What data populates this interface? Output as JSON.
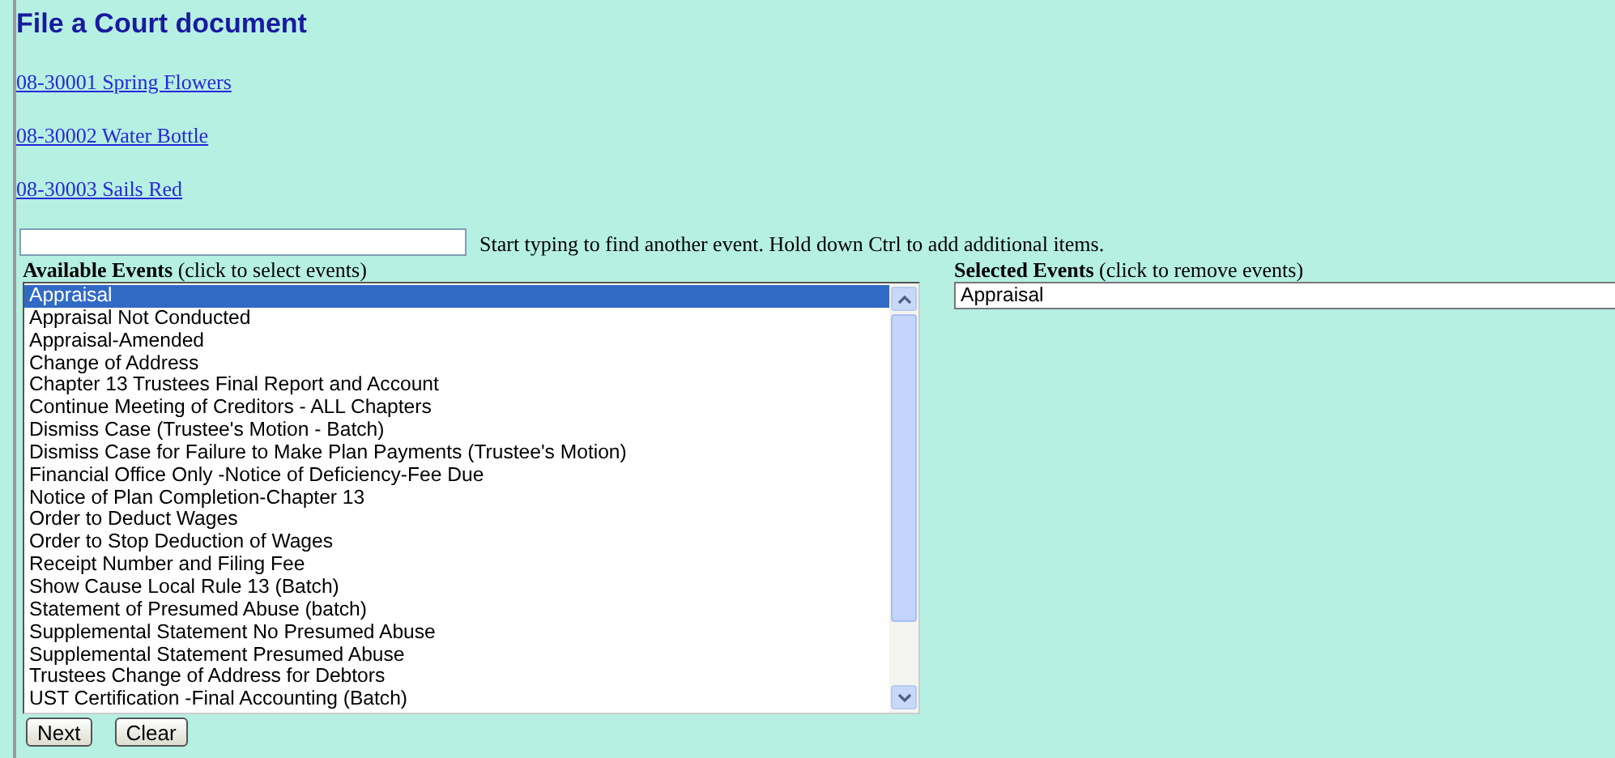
{
  "title": "File a Court document",
  "case_links": [
    "08-30001 Spring Flowers",
    "08-30002 Water Bottle",
    "08-30003 Sails Red"
  ],
  "search": {
    "hint": "Start typing to find another event. Hold down Ctrl to add additional items."
  },
  "available_events": {
    "label": "Available Events",
    "note": "(click to select events)",
    "items": [
      {
        "label": "Appraisal",
        "selected": true
      },
      {
        "label": "Appraisal Not Conducted",
        "selected": false
      },
      {
        "label": "Appraisal-Amended",
        "selected": false
      },
      {
        "label": "Change of Address",
        "selected": false
      },
      {
        "label": "Chapter 13 Trustees Final Report and Account",
        "selected": false
      },
      {
        "label": "Continue Meeting of Creditors - ALL Chapters",
        "selected": false
      },
      {
        "label": "Dismiss Case (Trustee's Motion - Batch)",
        "selected": false
      },
      {
        "label": "Dismiss Case for Failure to Make Plan Payments (Trustee's Motion)",
        "selected": false
      },
      {
        "label": "Financial Office Only -Notice of Deficiency-Fee Due",
        "selected": false
      },
      {
        "label": "Notice of Plan Completion-Chapter 13",
        "selected": false
      },
      {
        "label": "Order to Deduct Wages",
        "selected": false
      },
      {
        "label": "Order to Stop Deduction of Wages",
        "selected": false
      },
      {
        "label": "Receipt Number and Filing Fee",
        "selected": false
      },
      {
        "label": "Show Cause Local Rule 13 (Batch)",
        "selected": false
      },
      {
        "label": "Statement of Presumed Abuse (batch)",
        "selected": false
      },
      {
        "label": "Supplemental Statement No Presumed Abuse",
        "selected": false
      },
      {
        "label": "Supplemental Statement Presumed Abuse",
        "selected": false
      },
      {
        "label": "Trustees Change of Address for Debtors",
        "selected": false
      },
      {
        "label": "UST Certification -Final Accounting (Batch)",
        "selected": false
      }
    ]
  },
  "selected_events": {
    "label": "Selected Events",
    "note": "(click to remove events)",
    "items": [
      "Appraisal"
    ]
  },
  "buttons": [
    "Next",
    "Clear"
  ]
}
